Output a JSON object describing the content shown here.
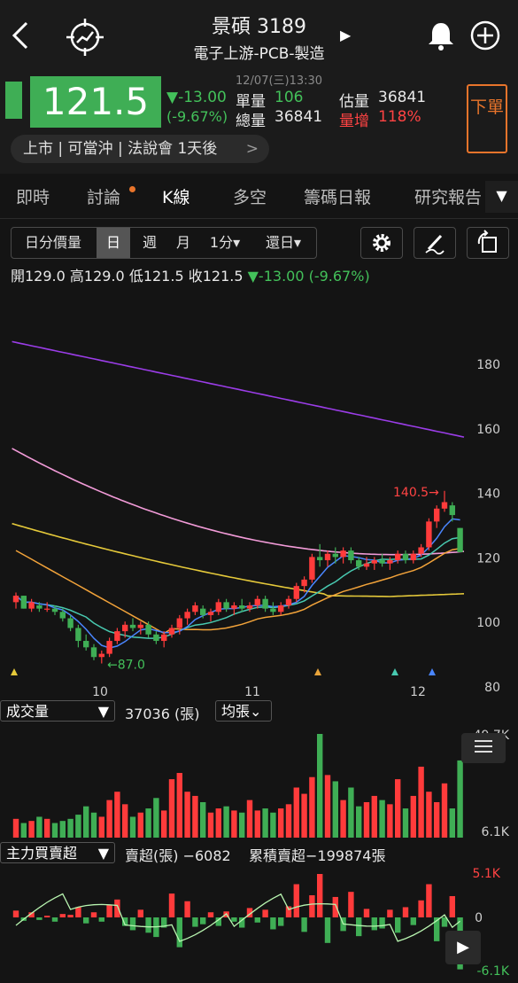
{
  "header": {
    "title": "景碩 3189",
    "subtitle": "電子上游-PCB-製造",
    "subtitle_arrow": "▶"
  },
  "quote": {
    "price": "121.5",
    "change": "▼-13.00",
    "change_pct": "(-9.67%)",
    "datetime": "12/07(三)13:30",
    "unit_vol_label": "單量",
    "unit_vol": "106",
    "total_vol_label": "總量",
    "total_vol": "36841",
    "est_vol_label": "估量",
    "est_vol": "36841",
    "vol_increase_label": "量增",
    "vol_increase": "118%",
    "order_button": "下單",
    "listing_info": "上市 | 可當沖 | 法說會 1天後",
    "listing_chevron": ">"
  },
  "tabs": [
    "即時",
    "討論",
    "K線",
    "多空",
    "籌碼日報",
    "研究報告"
  ],
  "tab_more": "▼",
  "toolbar": {
    "tick_label": "日分價量",
    "day_label": "日",
    "week_label": "週",
    "month_label": "月",
    "minute_label": "1分▾",
    "restore_label": "還日▾"
  },
  "ohlc": {
    "open": "開129.0",
    "high": "高129.0",
    "low": "低121.5",
    "close": "收121.5",
    "change": "▼-13.00 (-9.67%)"
  },
  "volume_panel": {
    "selector": "成交量",
    "selector_arrow": "▼",
    "value": "37036 (張)",
    "avg_selector": "均張⌄",
    "max_label": "49.7K",
    "min_label": "6.1K"
  },
  "flow_panel": {
    "selector": "主力買賣超",
    "selector_arrow": "▼",
    "sell": "賣超(張) −6082",
    "cum": "累積賣超−199874張",
    "max_label": "5.1K",
    "zero_label": "0",
    "min_label": "-6.1K"
  },
  "colors": {
    "up": "#ff3b3b",
    "down": "#3fae55",
    "accent": "#e8742b"
  },
  "chart_data": {
    "type": "candlestick",
    "y_ticks": [
      "180",
      "160",
      "140",
      "120",
      "100",
      "80"
    ],
    "x_ticks": [
      "10",
      "11",
      "12"
    ],
    "ylim": [
      80,
      190
    ],
    "annotations": {
      "high": "140.5→",
      "low": "←87.0"
    },
    "candles": [
      [
        106,
        109,
        104,
        108
      ],
      [
        108,
        108,
        104,
        104
      ],
      [
        104,
        107,
        103,
        106
      ],
      [
        105,
        106,
        103,
        104
      ],
      [
        104,
        106,
        103,
        104
      ],
      [
        104,
        105,
        102,
        103
      ],
      [
        103,
        104,
        100,
        101
      ],
      [
        101,
        102,
        97,
        98
      ],
      [
        98,
        99,
        92,
        94
      ],
      [
        94,
        96,
        91,
        92
      ],
      [
        92,
        93,
        88,
        89
      ],
      [
        89,
        91,
        87,
        90
      ],
      [
        90,
        95,
        89,
        94
      ],
      [
        94,
        98,
        93,
        97
      ],
      [
        97,
        100,
        95,
        99
      ],
      [
        99,
        101,
        97,
        98
      ],
      [
        98,
        100,
        96,
        99
      ],
      [
        99,
        100,
        95,
        96
      ],
      [
        96,
        97,
        93,
        94
      ],
      [
        94,
        97,
        92,
        96
      ],
      [
        96,
        99,
        95,
        98
      ],
      [
        98,
        102,
        96,
        101
      ],
      [
        101,
        104,
        99,
        103
      ],
      [
        103,
        106,
        102,
        105
      ],
      [
        104,
        105,
        101,
        102
      ],
      [
        102,
        104,
        100,
        103
      ],
      [
        103,
        107,
        102,
        106
      ],
      [
        106,
        107,
        103,
        104
      ],
      [
        104,
        106,
        102,
        105
      ],
      [
        105,
        107,
        103,
        104
      ],
      [
        104,
        106,
        103,
        105
      ],
      [
        105,
        108,
        104,
        107
      ],
      [
        107,
        108,
        103,
        104
      ],
      [
        104,
        106,
        102,
        103
      ],
      [
        103,
        106,
        102,
        105
      ],
      [
        105,
        108,
        104,
        107
      ],
      [
        107,
        112,
        106,
        111
      ],
      [
        111,
        114,
        109,
        113
      ],
      [
        113,
        121,
        112,
        120
      ],
      [
        120,
        124,
        117,
        119
      ],
      [
        119,
        122,
        117,
        121
      ],
      [
        121,
        123,
        118,
        120
      ],
      [
        120,
        123,
        118,
        122
      ],
      [
        122,
        123,
        118,
        119
      ],
      [
        119,
        120,
        116,
        117
      ],
      [
        117,
        120,
        116,
        118
      ],
      [
        118,
        120,
        116,
        119
      ],
      [
        119,
        121,
        117,
        118
      ],
      [
        118,
        120,
        116,
        119
      ],
      [
        119,
        122,
        118,
        121
      ],
      [
        121,
        122,
        118,
        119
      ],
      [
        119,
        122,
        118,
        121
      ],
      [
        121,
        124,
        120,
        123
      ],
      [
        123,
        132,
        122,
        131
      ],
      [
        131,
        136,
        129,
        135
      ],
      [
        135,
        140.5,
        134,
        137
      ],
      [
        136,
        137,
        131,
        133
      ],
      [
        129,
        129,
        121.5,
        121.5
      ]
    ],
    "ma_lines": [
      {
        "name": "MA5",
        "color": "#4a86ff"
      },
      {
        "name": "MA10",
        "color": "#48c9b0"
      },
      {
        "name": "MA20",
        "color": "#f2a33a"
      },
      {
        "name": "MA60",
        "color": "#e5c93a"
      },
      {
        "name": "MA120",
        "color": "#f29bd8"
      },
      {
        "name": "MA240",
        "color": "#9b3de8"
      }
    ],
    "volume": [
      9,
      7,
      8,
      10,
      9,
      7,
      8,
      9,
      11,
      15,
      12,
      10,
      18,
      22,
      16,
      10,
      12,
      14,
      19,
      13,
      28,
      31,
      22,
      20,
      17,
      12,
      14,
      15,
      13,
      12,
      18,
      13,
      14,
      12,
      14,
      16,
      24,
      21,
      29,
      49.7,
      30,
      27,
      18,
      24,
      15,
      17,
      20,
      18,
      16,
      28,
      14,
      20,
      34,
      22,
      17,
      26,
      14,
      37
    ],
    "flow": [
      0.8,
      -0.4,
      0.6,
      -0.3,
      0.2,
      -0.5,
      0.4,
      0.3,
      1.2,
      -0.7,
      0.6,
      -0.5,
      1.5,
      2.1,
      -1.0,
      -1.5,
      0.9,
      -1.8,
      -2.3,
      -1.2,
      2.8,
      -3.5,
      1.9,
      -1.1,
      -0.8,
      0.6,
      -1.0,
      0.7,
      -0.5,
      -1.2,
      1.1,
      -0.6,
      0.9,
      -1.4,
      -1.0,
      1.3,
      3.9,
      -1.7,
      2.6,
      5.1,
      -3.0,
      2.4,
      -1.6,
      3.0,
      -2.2,
      1.0,
      -1.5,
      -1.3,
      0.9,
      -1.8,
      1.2,
      -0.9,
      2.0,
      3.9,
      -2.8,
      -1.1,
      2.5,
      -6.1
    ]
  }
}
